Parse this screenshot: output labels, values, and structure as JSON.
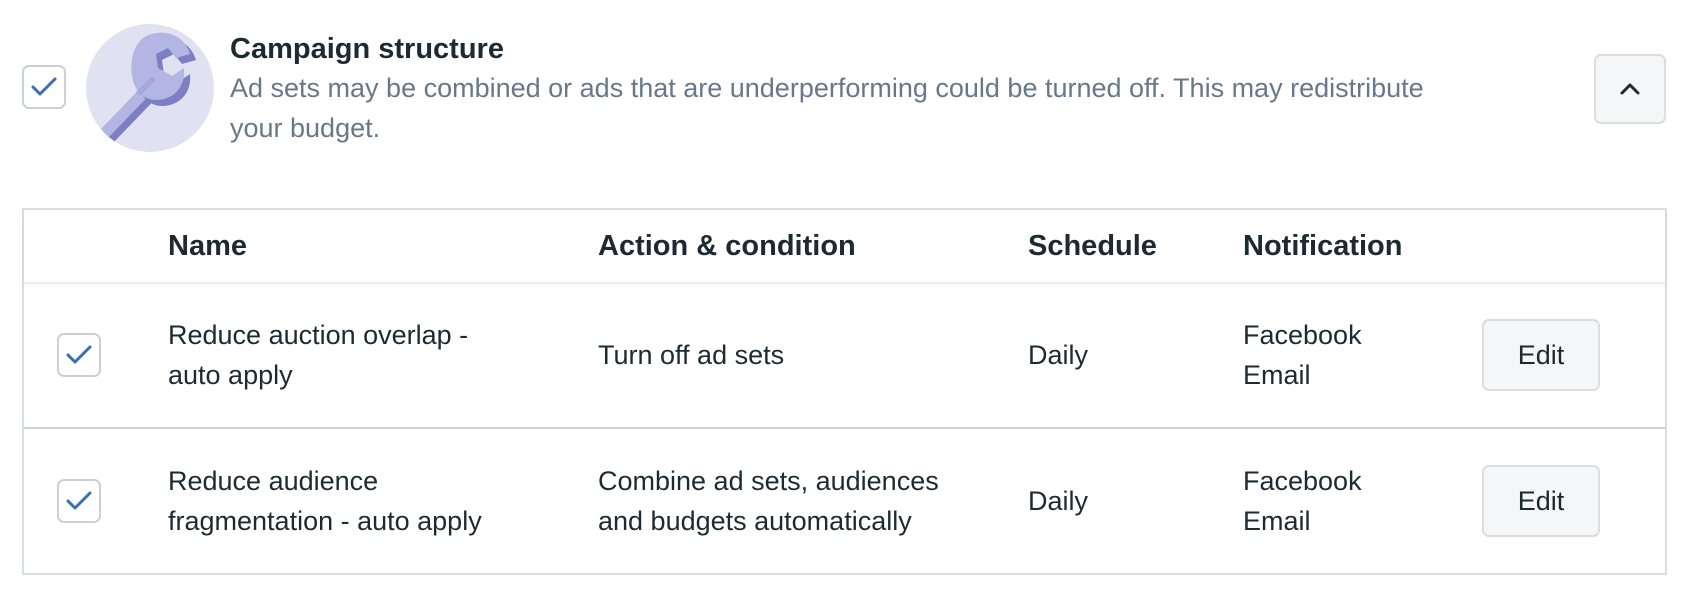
{
  "header": {
    "checkbox_checked": true,
    "icon": "wrench-icon",
    "title": "Campaign structure",
    "description_lines": [
      "Ad sets may be combined or ads that are underperforming could be turned off. This may redistribute",
      "your budget."
    ],
    "collapse_icon": "chevron-up-icon"
  },
  "table": {
    "columns": [
      "Name",
      "Action & condition",
      "Schedule",
      "Notification"
    ],
    "rows": [
      {
        "checked": true,
        "name_lines": [
          "Reduce auction overlap -",
          "auto apply"
        ],
        "action_lines": [
          "Turn off ad sets"
        ],
        "schedule": "Daily",
        "notification_lines": [
          "Facebook",
          "Email"
        ],
        "edit_label": "Edit"
      },
      {
        "checked": true,
        "name_lines": [
          "Reduce audience",
          "fragmentation - auto apply"
        ],
        "action_lines": [
          "Combine ad sets, audiences",
          "and budgets automatically"
        ],
        "schedule": "Daily",
        "notification_lines": [
          "Facebook",
          "Email"
        ],
        "edit_label": "Edit"
      }
    ]
  },
  "colors": {
    "check_blue": "#1877f2",
    "checkmark": "#3a6fb0",
    "text_primary": "#1c2b33",
    "text_secondary": "#67788a",
    "avatar_bg": "#e0e2f1",
    "wrench": "#9fa3d8"
  }
}
